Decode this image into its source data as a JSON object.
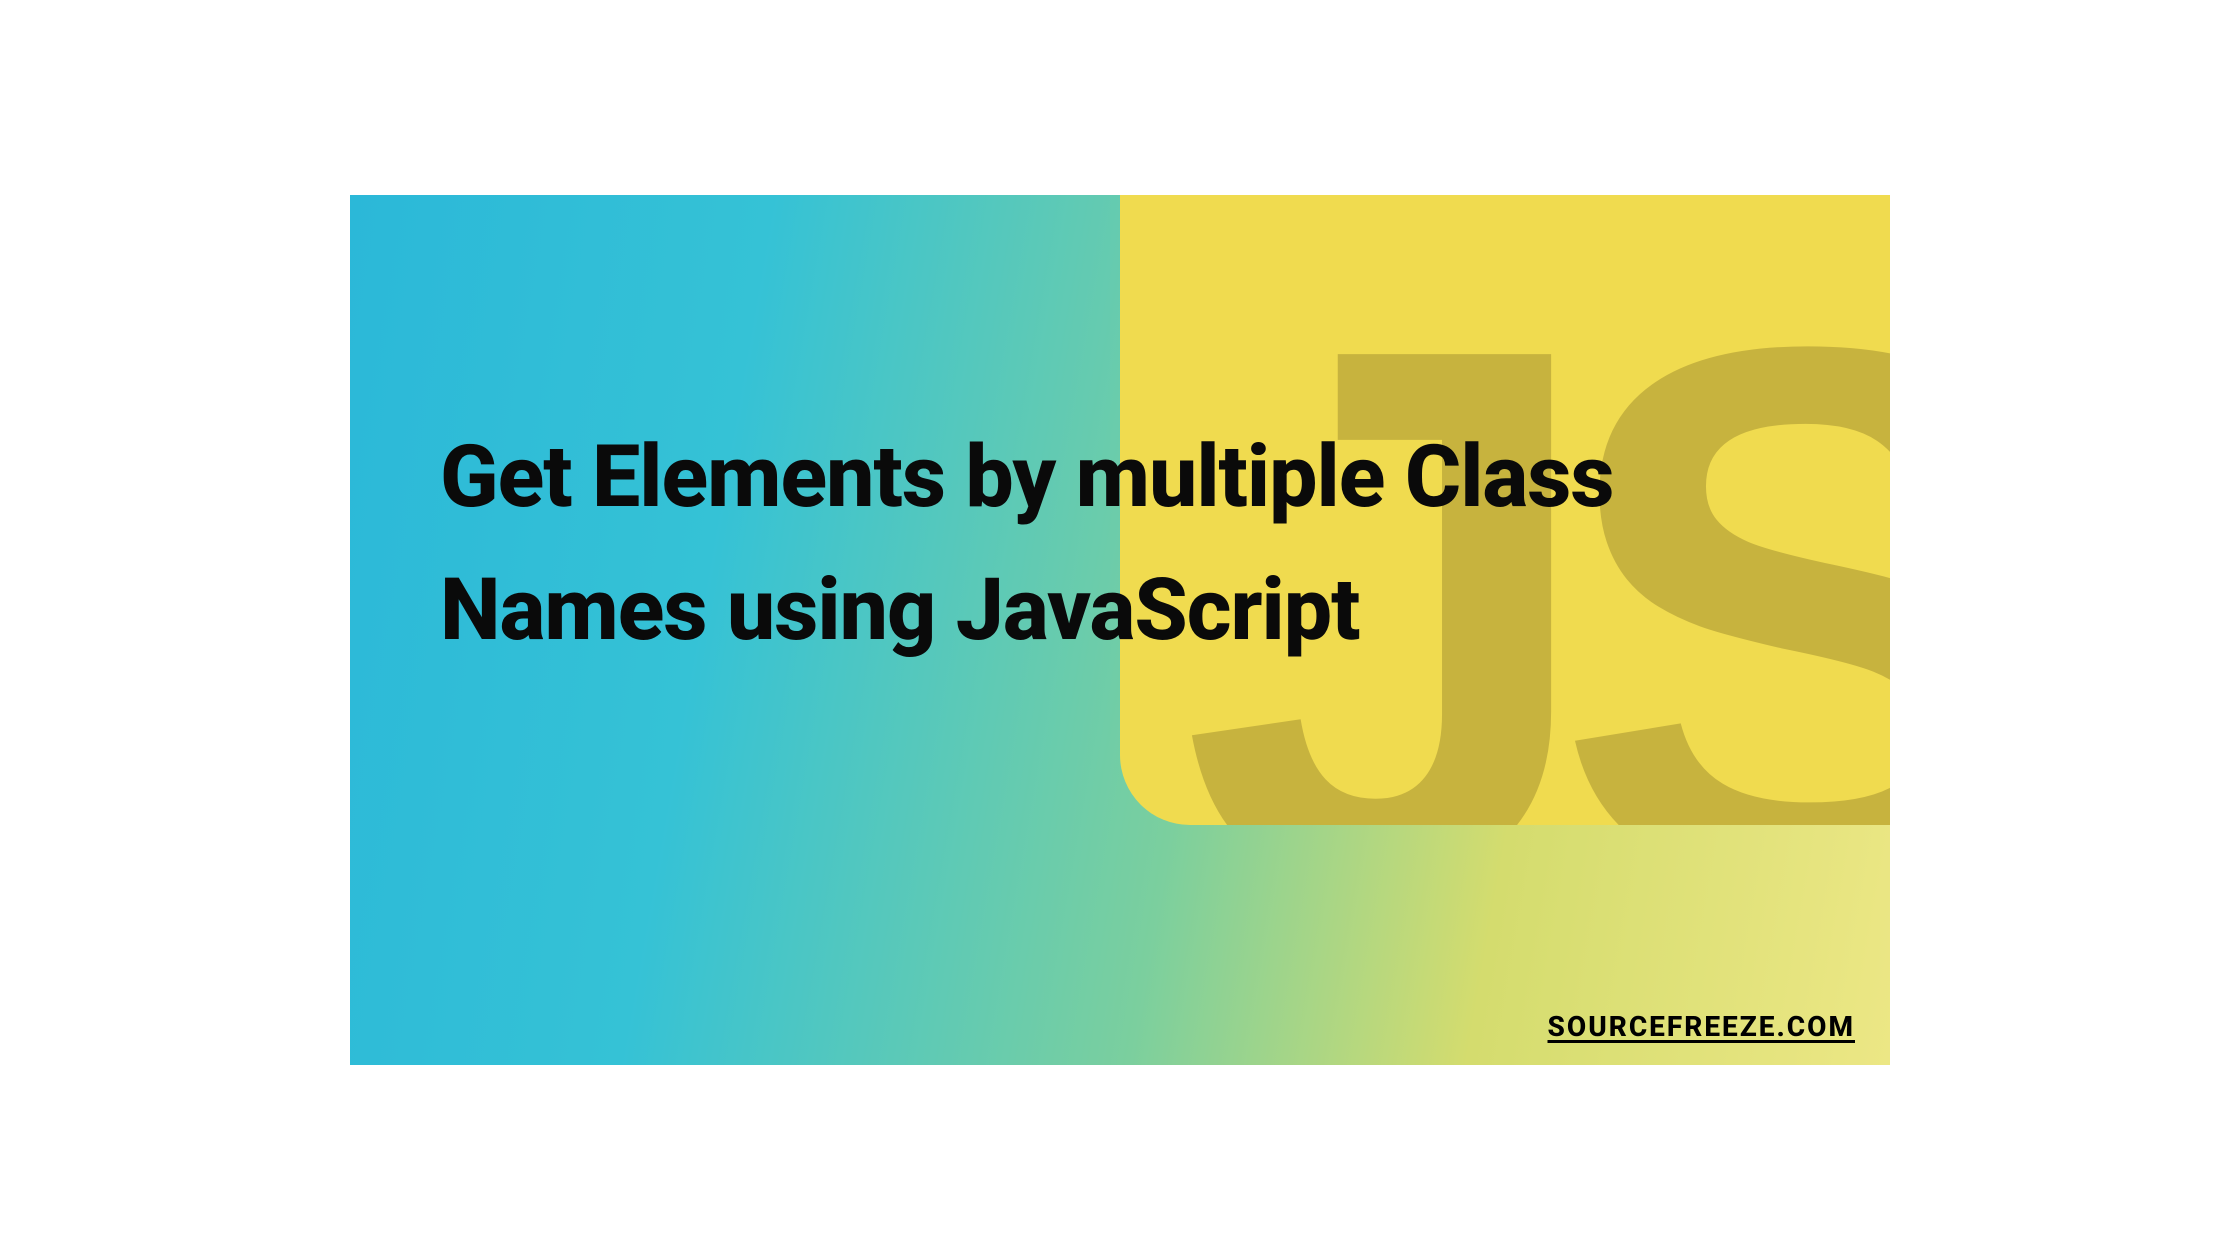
{
  "heading": "Get Elements by multiple Class Names using JavaScript",
  "badge_text": "JS",
  "source": "SOURCEFREEZE.COM"
}
